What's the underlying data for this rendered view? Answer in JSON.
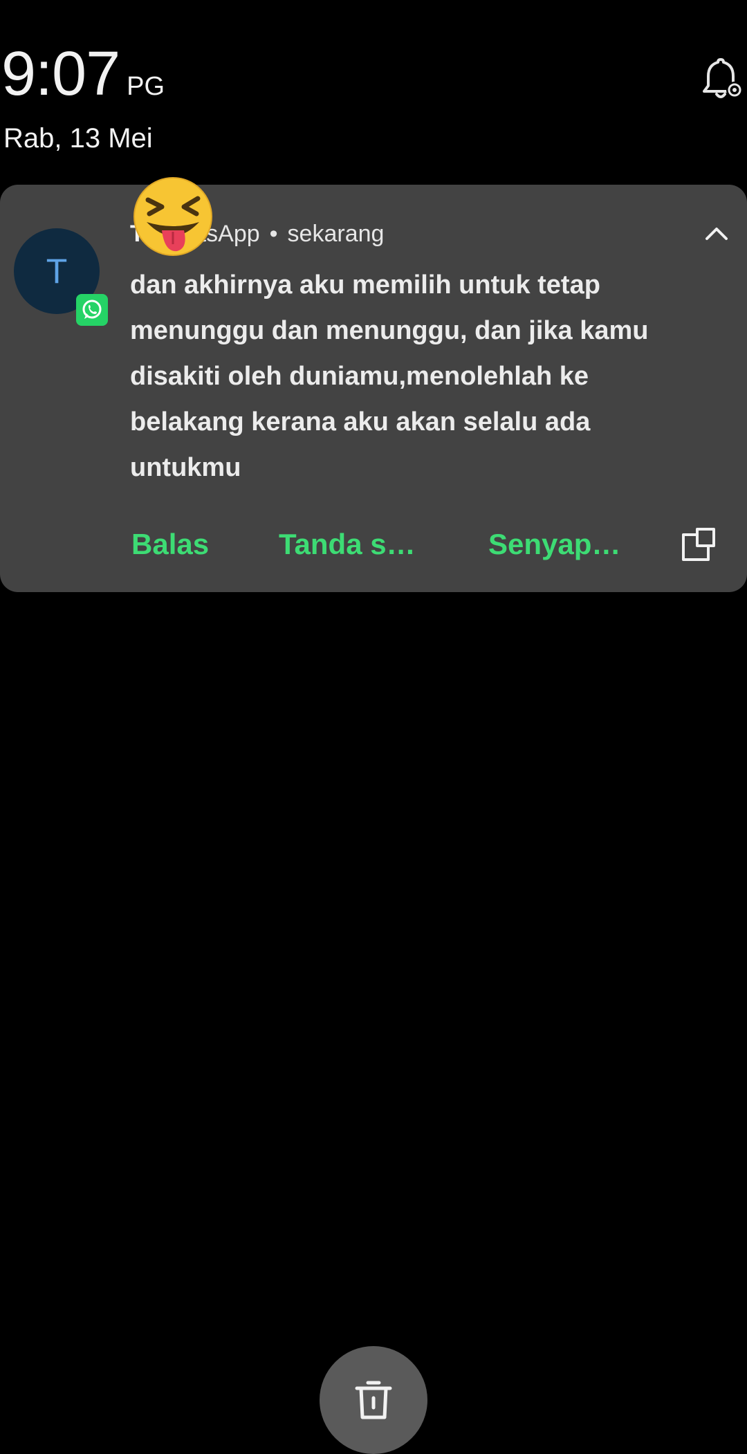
{
  "lockscreen": {
    "time": "9:07",
    "ampm": "PG",
    "date": "Rab, 13 Mei"
  },
  "notification": {
    "avatar_letter": "T",
    "sender": "T",
    "app": "WhatsApp",
    "separator": "•",
    "time": "sekarang",
    "message": "dan akhirnya aku memilih untuk tetap menunggu dan menunggu, dan jika kamu disakiti oleh duniamu,menolehlah ke belakang kerana aku akan selalu ada untukmu",
    "actions": {
      "reply": "Balas",
      "mark_read": "Tanda s…",
      "mute": "Senyap…"
    }
  },
  "icons": {
    "notification_settings": "bell-settings-icon",
    "expand": "chevron-up-icon",
    "app_badge": "whatsapp-icon",
    "overlay": "laughing-tongue-emoji",
    "action_expand": "expand-window-icon",
    "clear_all": "trash-icon"
  },
  "colors": {
    "card_background": "#434343",
    "action_text": "#3ddc74",
    "avatar_background": "#0f2a40",
    "avatar_letter": "#5fa3e6",
    "whatsapp_green": "#25d366"
  }
}
